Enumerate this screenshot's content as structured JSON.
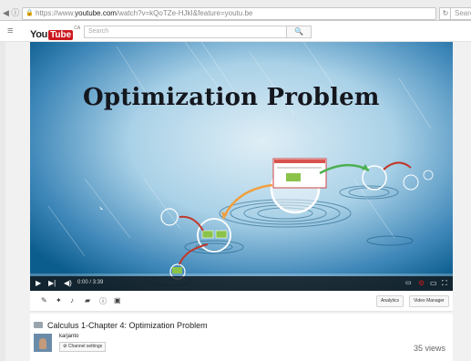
{
  "browser": {
    "url_prefix": "https://www.",
    "url_domain": "youtube.com",
    "url_rest": "/watch?v=kQoTZe-HJkI&feature=youtu.be",
    "search_placeholder": "Search"
  },
  "youtube": {
    "logo_you": "You",
    "logo_tube": "Tube",
    "logo_region": "CA",
    "search_placeholder": "Search"
  },
  "player": {
    "slide_title": "Optimization Problem",
    "time": "0:00 / 3:39",
    "progress": 0.0
  },
  "toolbar": {
    "analytics_label": "Analytics",
    "video_manager_label": "Video Manager"
  },
  "video": {
    "title": "Calculus 1-Chapter 4: Optimization Problem",
    "channel": "karjanto",
    "channel_settings_label": "Channel settings",
    "views": "35 views"
  },
  "colors": {
    "accent": "#cc181e",
    "player_bg": "#0b5d8d"
  }
}
